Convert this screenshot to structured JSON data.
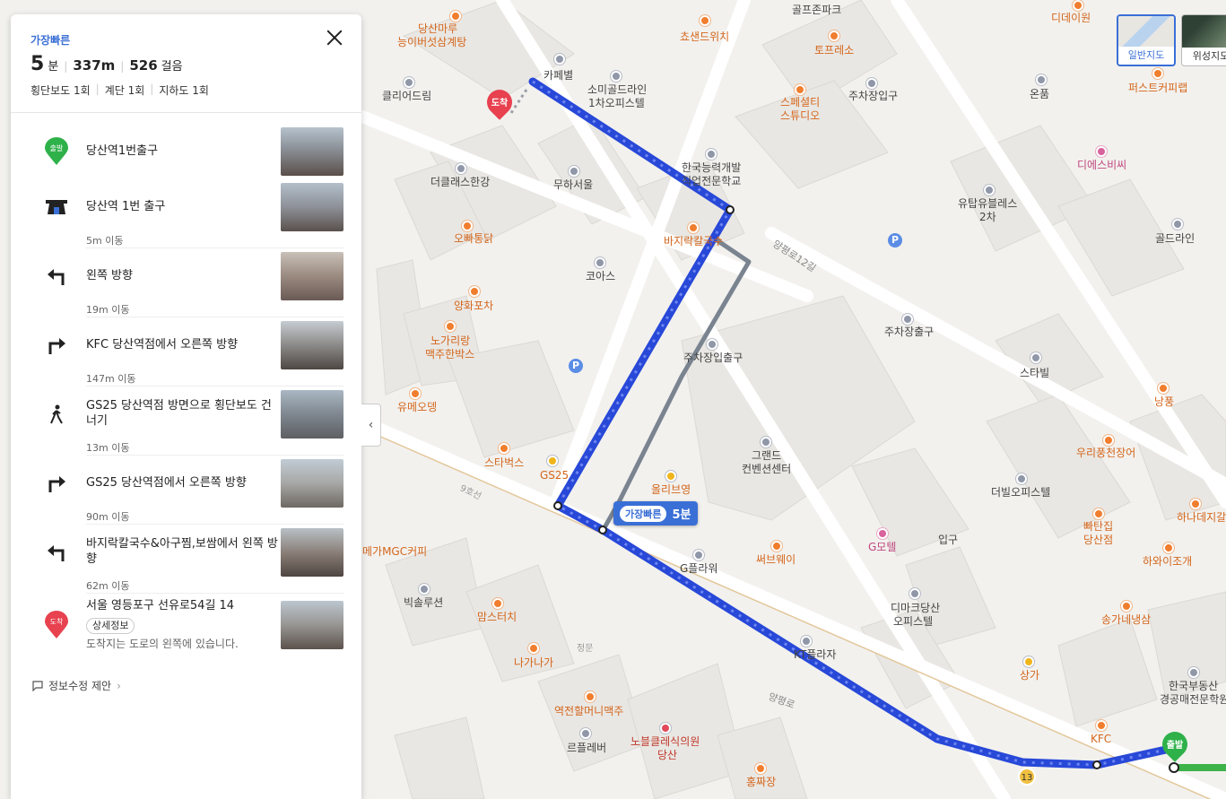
{
  "panel": {
    "tag": "가장빠른",
    "minutes": "5",
    "minutes_unit": "분",
    "distance": "337m",
    "steps_count": "526",
    "steps_unit": "걸음",
    "crosswalk": "횡단보도 1회",
    "stairs": "계단 1회",
    "underpass": "지하도 1회",
    "suggest": "정보수정 제안",
    "steps": [
      {
        "icon": "start-pin-icon",
        "badge": "출발",
        "text": "당산역1번출구",
        "dist": ""
      },
      {
        "icon": "subway-exit-icon",
        "text": "당산역 1번 출구",
        "dist": "5m 이동"
      },
      {
        "icon": "turn-left-icon",
        "text": "왼쪽 방향",
        "dist": "19m 이동"
      },
      {
        "icon": "turn-right-icon",
        "text": "KFC 당산역점에서 오른쪽 방향",
        "dist": "147m 이동"
      },
      {
        "icon": "crosswalk-walk-icon",
        "text": "GS25 당산역점 방면으로 횡단보도 건너기",
        "dist": "13m 이동"
      },
      {
        "icon": "turn-right-icon",
        "text": "GS25 당산역점에서 오른쪽 방향",
        "dist": "90m 이동"
      },
      {
        "icon": "turn-left-icon",
        "text": "바지락칼국수&아구찜,보쌈에서 왼쪽 방향",
        "dist": "62m 이동"
      },
      {
        "icon": "end-pin-icon",
        "badge": "도착",
        "text": "서울 영등포구 선유로54길 14",
        "sub": "상세정보",
        "note": "도착지는 도로의 왼쪽에 있습니다.",
        "dist": ""
      }
    ]
  },
  "map": {
    "route_badge_label": "가장빠른",
    "route_badge_time": "5분",
    "map_types": [
      "일반지도",
      "위성지도"
    ],
    "start_label": "출발",
    "end_label": "도착",
    "labels": [
      "당산마루",
      "능이버섯삼계탕",
      "카페별",
      "소미골드라인",
      "1차오피스텔",
      "쵸샌드위치",
      "골프존파크",
      "토프레소",
      "스페셜티",
      "스튜디오",
      "주차장입구",
      "디데이원",
      "온품",
      "퍼스트커피랩",
      "클리어드림",
      "더클래스한강",
      "무하서울",
      "한국능력개발",
      "직업전문학교",
      "디에스비씨",
      "유탑유블레스",
      "2차",
      "골드라인",
      "오빠통닭",
      "바지락칼국수",
      "양평로12길",
      "코아스",
      "양화포차",
      "노가리랑",
      "맥주한박스",
      "주차장입출구",
      "주차장출구",
      "스타빌",
      "유메오뎅",
      "스타벅스",
      "GS25",
      "그랜드",
      "컨벤션센터",
      "올리브영",
      "더빌오피스텔",
      "우리풍천장어",
      "빠탄집",
      "당산점",
      "하나데지갈",
      "하와이조개",
      "메가MGC커피",
      "G플라워",
      "써브웨이",
      "G모텔",
      "빅솔루션",
      "맘스터치",
      "나가나가",
      "디마크당산",
      "오피스텔",
      "KT플라자",
      "상가",
      "송가네냉삼",
      "한국부동산",
      "경공매전문학원",
      "역전할머니맥주",
      "르플레버",
      "노블클레식의원",
      "당산",
      "홍짜장",
      "KFC",
      "양평로",
      "9호선",
      "정문",
      "입구",
      "낭풍"
    ]
  }
}
